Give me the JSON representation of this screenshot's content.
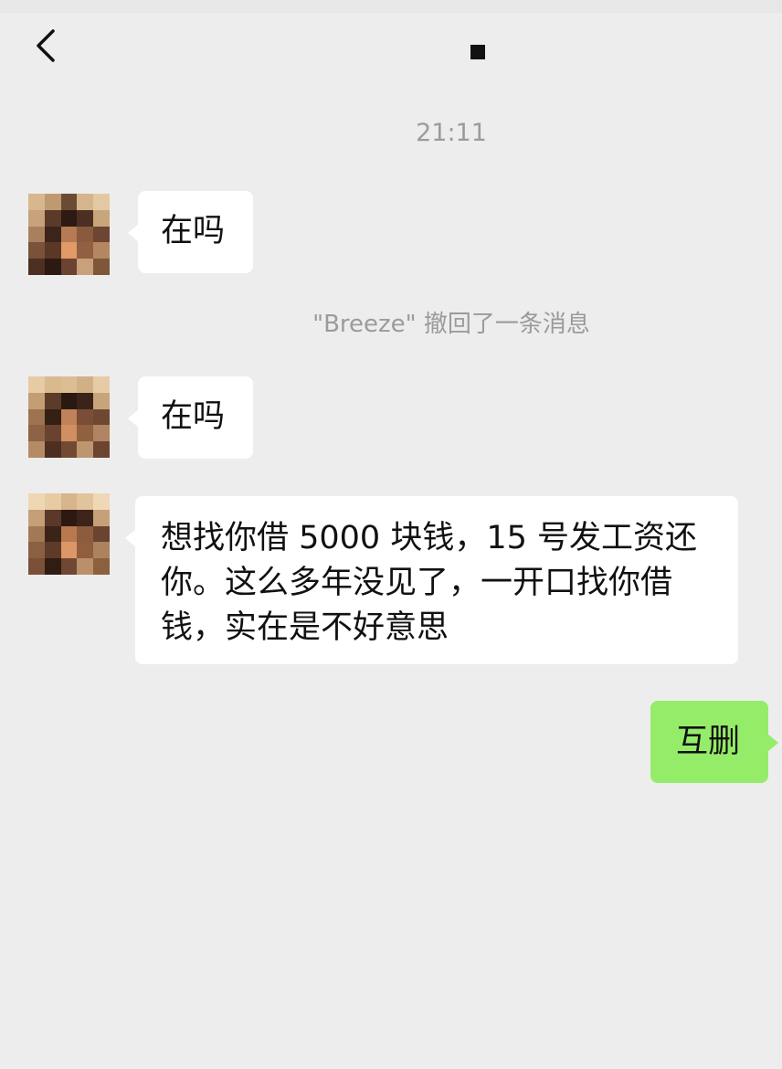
{
  "header": {
    "back_icon": "chevron-left-icon",
    "title_mark_color": "#111111"
  },
  "chat": {
    "timestamp": "21:11",
    "recall_notice": "\"Breeze\" 撤回了一条消息",
    "messages": [
      {
        "side": "left",
        "text": "在吗"
      },
      {
        "side": "left",
        "text": "在吗"
      },
      {
        "side": "left",
        "text": "想找你借 5000 块钱，15 号发工资还你。这么多年没见了，一开口找你借钱，实在是不好意思"
      },
      {
        "side": "right",
        "text": "互删"
      }
    ]
  },
  "colors": {
    "background": "#ededed",
    "incoming_bubble": "#ffffff",
    "outgoing_bubble": "#95ec69",
    "system_text": "#9b9b9b"
  }
}
